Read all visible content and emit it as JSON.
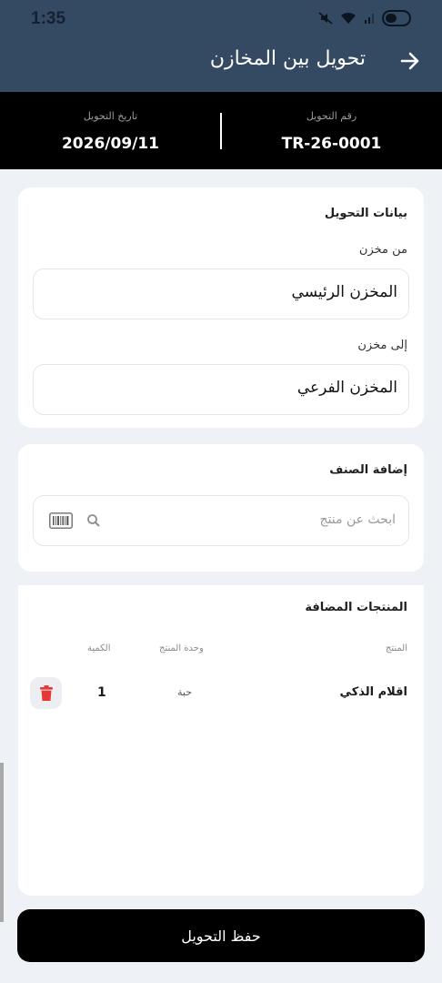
{
  "status_bar": {
    "time": "1:35"
  },
  "header": {
    "title": "تحويل بين المخازن"
  },
  "transfer_info": {
    "number_label": "رقم التحويل",
    "number_value": "TR-26-0001",
    "date_label": "تاريخ التحويل",
    "date_value": "2026/09/11"
  },
  "transfer_data": {
    "title": "بيانات التحويل",
    "from_label": "من مخزن",
    "from_value": "المخزن الرئيسي",
    "to_label": "إلى مخزن",
    "to_value": "المخزن الفرعي"
  },
  "add_item": {
    "title": "إضافة الصنف",
    "search_placeholder": "ابحث عن منتج"
  },
  "added_products": {
    "title": "المنتجات المضافة",
    "columns": {
      "product": "المنتج",
      "unit": "وحدة المنتج",
      "quantity": "الكمية"
    },
    "rows": [
      {
        "name": "اقلام الذكي",
        "unit": "حبة",
        "quantity": "1"
      }
    ]
  },
  "footer": {
    "save_label": "حفظ التحويل"
  },
  "colors": {
    "header_bg": "#344a62",
    "info_bar_bg": "#000000",
    "delete_red": "#e53935",
    "page_bg": "#eef1f5"
  }
}
